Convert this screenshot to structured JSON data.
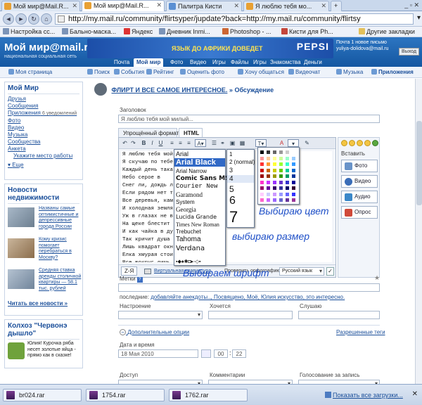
{
  "browser": {
    "tabs": [
      {
        "label": "Мой мир@Mail.R...",
        "active": false
      },
      {
        "label": "Мой мир@Mail.R...",
        "active": true
      },
      {
        "label": "Палитра Кисти",
        "active": false
      },
      {
        "label": "Я люблю тебя мо...",
        "active": false
      }
    ],
    "url": "http://my.mail.ru/community/flirtsyper/jupdate?back=http://my.mail.ru/community/flirtsy",
    "bookmarks": [
      "Настройка сс...",
      "Бально-маска...",
      "Яндекс",
      "Дневник Inmi...",
      "Photoshop - ...",
      "Кисти для Ph...",
      "Другие закладки"
    ]
  },
  "site": {
    "logo": "Мой мир@mail.ru",
    "logo_sub": "национальная социальная сеть",
    "ad_text": "ЯЗЫК ДО АФРИКИ ДОВЕДЕТ",
    "ad_brand": "PEPSI",
    "account_line1": "Почта  1 новое письмо",
    "account_email": "yuliya-dolidova@mail.ru",
    "logout": "Выход",
    "main_tabs": [
      "Почта",
      "Мой мир",
      "Фото",
      "Видео",
      "Игры",
      "Файлы",
      "Игры",
      "Знакомства",
      "Деньги"
    ],
    "services": [
      "Моя страница",
      "Поиск",
      "События",
      "Рейтинг",
      "Оценить фото",
      "Хочу общаться",
      "Видеочат",
      "Музыка",
      "Приложения"
    ]
  },
  "sidebar": {
    "title": "Мой Мир",
    "links": [
      "Друзья",
      "Сообщения",
      "Приложения",
      "Фото",
      "Видео",
      "Музыка",
      "Сообщества",
      "Анкета"
    ],
    "apps_count": "6 уведомлений",
    "settings_link": "Укажите место работы",
    "more": "Еще",
    "news_title": "Новости недвижимости",
    "news": [
      "Названы самые оптимистичные и депрессивные города России",
      "Кому кризис помогает перебраться в Москву?",
      "Средняя ставка аренды столичной квартиры — 58.1 тыс. рублей"
    ],
    "news_all": "Читать все новости »",
    "kolkhoz_title": "Колхоз \"Червонэ дышло\"",
    "kolkhoz_text": "Юлия! Курочка ряба несет золотые яйца - прямо как в сказке!"
  },
  "main": {
    "breadcrumb_group": "ФЛИРТ И ВСЕ САМОЕ ИНТЕРЕСНОЕ.",
    "breadcrumb_sep": "»",
    "breadcrumb_page": "Обсуждение",
    "title_label": "Заголовок",
    "title_value": "Я люблю тебя мой милый...",
    "editor_tabs": [
      "Упрощённый формат",
      "HTML"
    ],
    "editor_lines": [
      "Я люблю тебя мой",
      "Я скучаю по тебе",
      "Каждый день така",
      "Небо серое в",
      "Снег ли, дождь л",
      "Если рядом нет т",
      "Все деревья, кам",
      "И холодная земля",
      "Уж в глазах не в",
      "На щеке блестит",
      "И как чайка в ду",
      "Так  кричит душа",
      "Лишь квадрат окн",
      "Елка хмурая стои",
      "Все вокруг лишь",
      "Грустно, как гла"
    ],
    "font_list": [
      "Arial",
      "Arial Black",
      "Arial Narrow",
      "Comic Sans MS",
      "Courier New",
      "Garamond",
      "System",
      "Georgia",
      "Lucida Grande",
      "Times New Roman",
      "Trebuchet",
      "Tahoma",
      "Verdana"
    ],
    "font_selected": "Arial Black",
    "size_list": [
      "1",
      "2 (normal)",
      "3",
      "4",
      "5",
      "6",
      "7"
    ],
    "size_selected": "4",
    "insert_label": "Вставить",
    "insert_buttons": [
      "Фото",
      "Видео",
      "Аудио",
      "Опрос"
    ],
    "bottom_za": "Z-Я",
    "virtual_keyboard": "Виртуальная клавиатура",
    "spellcheck_label": "Проверить орфографию",
    "spellcheck_lang": "Русский язык",
    "ann_color": "Выбираю цвет",
    "ann_size": "выбираю размер",
    "ann_font": "Выбираем шрифт",
    "tags_label": "Метки",
    "tags_recent_label": "последние:",
    "tags_recent": "добавляйте анекдоты.., Посвящено, Моё, Юлия искусство, это интересно.",
    "mood_label": "Настроение",
    "want_label": "Хочется",
    "listen_label": "Слушаю",
    "more_options": "Дополнительные опции",
    "allowed_tags": "Разрешенные теги",
    "datetime_label": "Дата и время",
    "date_value": "18 Мая 2010",
    "hour_value": "00",
    "minute_value": "22",
    "access_label": "Доступ",
    "comments_label": "Комментарии",
    "vote_label": "Голосование за запись"
  },
  "downloads": {
    "items": [
      "br024.rar",
      "1754.rar",
      "1762.rar"
    ],
    "show_all": "Показать все загрузки..."
  }
}
